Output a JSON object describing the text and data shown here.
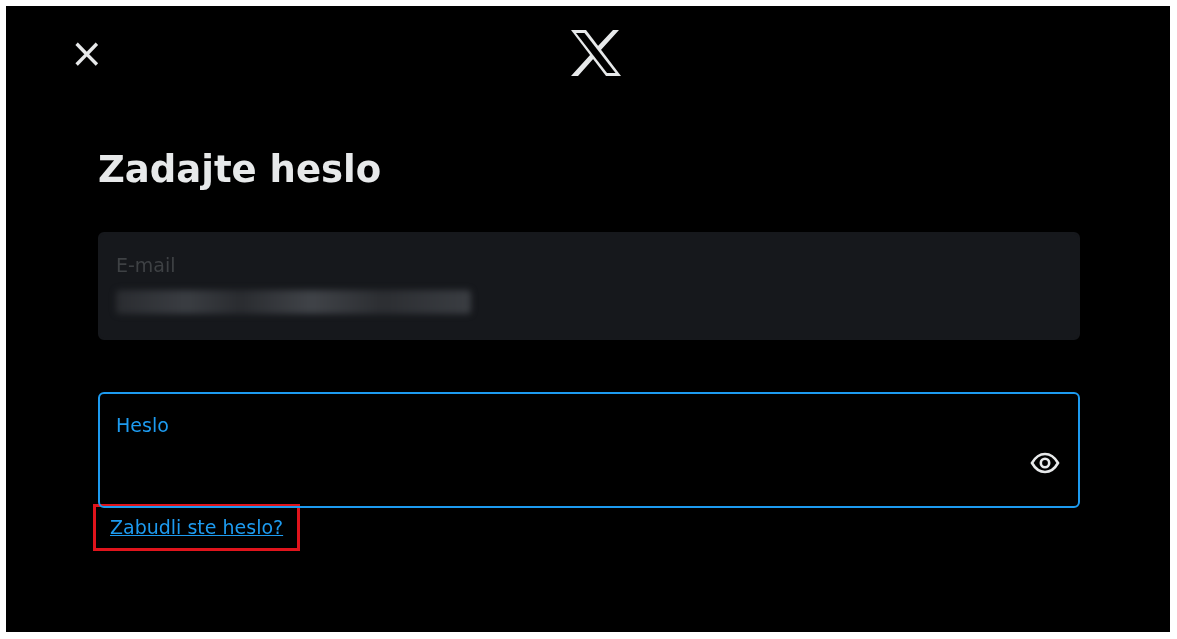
{
  "dialog": {
    "close": "×"
  },
  "title": "Zadajte heslo",
  "email_field": {
    "label": "E-mail",
    "disabled": true
  },
  "password_field": {
    "label": "Heslo",
    "focused": true
  },
  "forgot_link": {
    "text": "Zabudli ste heslo?",
    "highlighted": true
  }
}
